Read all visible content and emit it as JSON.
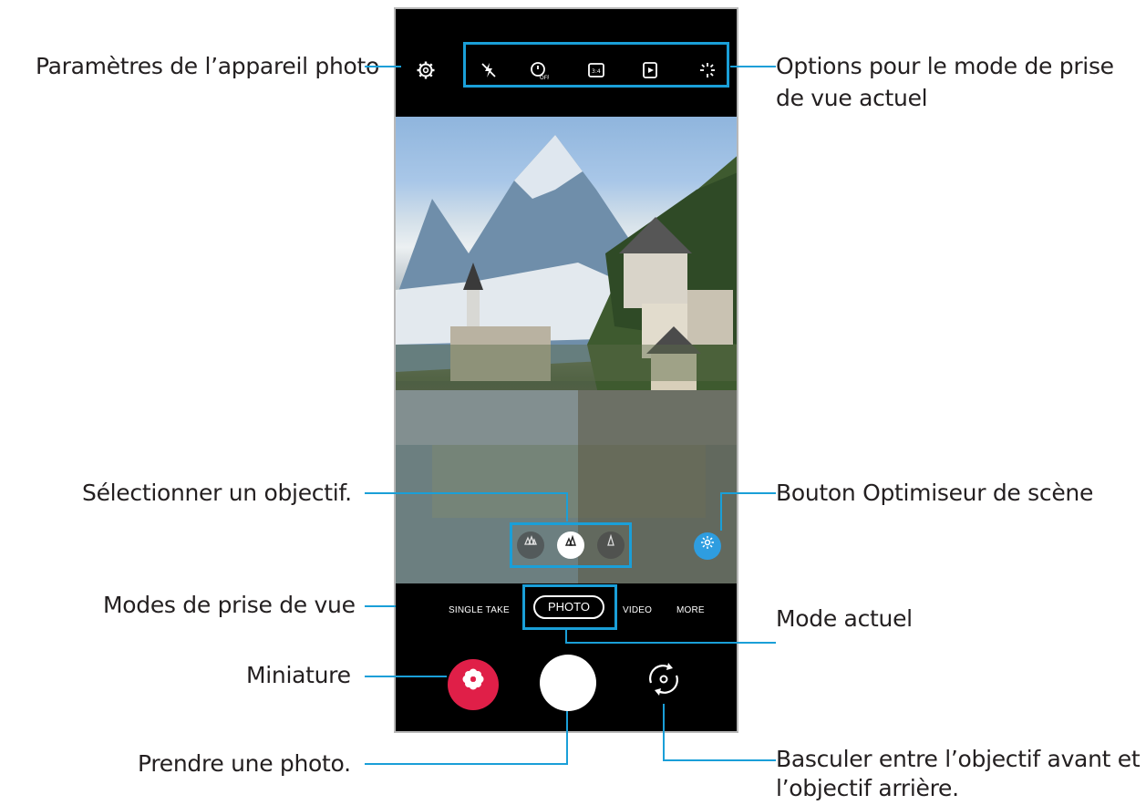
{
  "callouts": {
    "settings": "Paramètres de l’appareil photo",
    "options_line1": "Options pour le mode de prise",
    "options_line2": "de vue actuel",
    "select_lens": "Sélectionner un objectif.",
    "scene_optimizer": "Bouton Optimiseur de scène",
    "shooting_modes": "Modes de prise de vue",
    "current_mode": "Mode actuel",
    "thumbnail": "Miniature",
    "take_photo": "Prendre une photo.",
    "switch_line1": "Basculer entre l’objectif avant et",
    "switch_line2": "l’objectif arrière."
  },
  "camera": {
    "modes": [
      "SINGLE TAKE",
      "PHOTO",
      "VIDEO",
      "MORE"
    ],
    "current_mode": "PHOTO"
  },
  "colors": {
    "callout_line": "#1a9fd8",
    "scene_button": "#2e9de0",
    "thumbnail": "#e01f48"
  }
}
